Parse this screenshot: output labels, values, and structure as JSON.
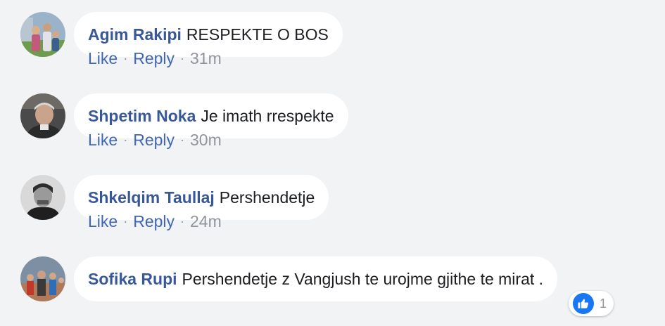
{
  "labels": {
    "like": "Like",
    "reply": "Reply",
    "separator": "·"
  },
  "comments": [
    {
      "author": "Agim Rakipi",
      "text": "RESPEKTE O BOS",
      "time": "31m"
    },
    {
      "author": "Shpetim Noka",
      "text": "Je imath rrespekte",
      "time": "30m"
    },
    {
      "author": "Shkelqim Taullaj",
      "text": "Pershendetje",
      "time": "24m"
    },
    {
      "author": "Sofika Rupi",
      "text": "Pershendetje z Vangjush te urojme gjithe te mirat .",
      "reaction_count": "1"
    }
  ],
  "colors": {
    "background": "#f2f3f5",
    "author": "#385898",
    "link": "#4267b2",
    "muted": "#90949c",
    "like_badge": "#1877f2"
  },
  "icons": {
    "reaction": "thumbs-up-icon"
  }
}
